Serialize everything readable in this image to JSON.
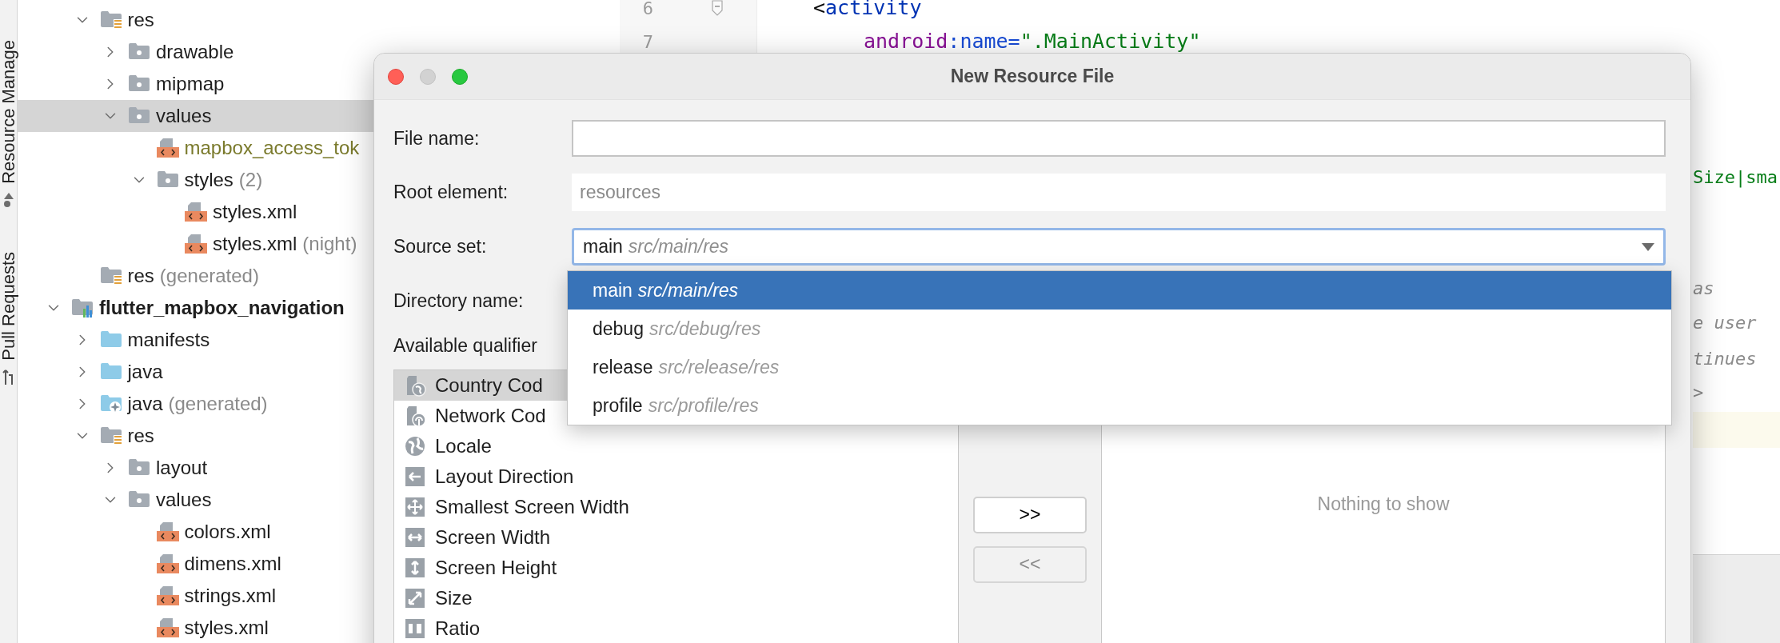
{
  "tool_strip": {
    "tabs": [
      {
        "label": "Resource Manage",
        "kind": "resources"
      },
      {
        "label": "Pull Requests",
        "kind": "pull"
      }
    ]
  },
  "project_tree": {
    "open_module_children": [
      {
        "label": "res",
        "kind": "res",
        "expanded": true,
        "selected": false,
        "children": [
          {
            "label": "drawable",
            "kind": "folder",
            "expanded": false,
            "selected": false
          },
          {
            "label": "mipmap",
            "kind": "folder",
            "expanded": false,
            "selected": false
          },
          {
            "label": "values",
            "kind": "folder",
            "expanded": true,
            "selected": true,
            "children": [
              {
                "label": "mapbox_access_tok",
                "kind": "xml",
                "selected": false,
                "color": "#7a7a2c"
              },
              {
                "label": "styles",
                "note": "(2)",
                "kind": "folder",
                "expanded": true,
                "selected": false,
                "children": [
                  {
                    "label": "styles.xml",
                    "kind": "xml",
                    "selected": false
                  },
                  {
                    "label": "styles.xml",
                    "note": "(night)",
                    "kind": "xml",
                    "selected": false
                  }
                ]
              }
            ]
          }
        ]
      },
      {
        "label": "res",
        "note": "(generated)",
        "kind": "res",
        "selected": false
      }
    ],
    "modules": [
      {
        "label": "flutter_mapbox_navigation",
        "kind": "module",
        "expanded": true,
        "selected": false,
        "children": [
          {
            "label": "manifests",
            "kind": "source",
            "expanded": false,
            "selected": false
          },
          {
            "label": "java",
            "kind": "source",
            "expanded": false,
            "selected": false
          },
          {
            "label": "java",
            "note": "(generated)",
            "kind": "generated",
            "expanded": false,
            "selected": false
          },
          {
            "label": "res",
            "kind": "res",
            "expanded": true,
            "selected": false,
            "children": [
              {
                "label": "layout",
                "kind": "folder",
                "expanded": false,
                "selected": false
              },
              {
                "label": "values",
                "kind": "folder",
                "expanded": true,
                "selected": false,
                "children": [
                  {
                    "label": "colors.xml",
                    "kind": "xml",
                    "selected": false
                  },
                  {
                    "label": "dimens.xml",
                    "kind": "xml",
                    "selected": false
                  },
                  {
                    "label": "strings.xml",
                    "kind": "xml",
                    "selected": false
                  },
                  {
                    "label": "styles.xml",
                    "kind": "xml",
                    "selected": false
                  }
                ]
              }
            ]
          }
        ]
      }
    ]
  },
  "editor": {
    "lines": [
      {
        "number": "6",
        "fold": true,
        "tokens": [
          {
            "text": "<",
            "kind": "punct"
          },
          {
            "text": "activity",
            "kind": "tag"
          }
        ]
      },
      {
        "number": "7",
        "fold": false,
        "tokens": [
          {
            "text": "android",
            "kind": "ns"
          },
          {
            "text": ":name=",
            "kind": "attr"
          },
          {
            "text": "\".MainActivity\"",
            "kind": "string"
          }
        ]
      }
    ],
    "right_fragments": [
      {
        "text": "Size|sma",
        "kind": "string"
      },
      {
        "text": "as",
        "kind": "comment"
      },
      {
        "text": "e user",
        "kind": "comment"
      },
      {
        "text": "tinues",
        "kind": "comment"
      },
      {
        "text": ">",
        "kind": "comment"
      }
    ],
    "caret_line_visible": true
  },
  "dialog": {
    "title": "New Resource File",
    "window_buttons": [
      {
        "kind": "close",
        "disabled": false
      },
      {
        "kind": "minimize",
        "disabled": true
      },
      {
        "kind": "zoom",
        "disabled": false
      }
    ],
    "file_name": {
      "label": "File name:"
    },
    "root_element": {
      "label": "Root element:",
      "value": "resources"
    },
    "source_set": {
      "label": "Source set:",
      "value": "main",
      "path": "src/main/res",
      "expanded": true,
      "options": [
        {
          "name": "main",
          "path": "src/main/res",
          "selected": true
        },
        {
          "name": "debug",
          "path": "src/debug/res",
          "selected": false
        },
        {
          "name": "release",
          "path": "src/release/res",
          "selected": false
        },
        {
          "name": "profile",
          "path": "src/profile/res",
          "selected": false
        }
      ]
    },
    "directory_name": {
      "label": "Directory name:"
    },
    "qualifiers_label": "Available qualifier",
    "qualifiers": [
      {
        "label": "Country Cod",
        "kind": "country",
        "selected": true
      },
      {
        "label": "Network Cod",
        "kind": "network",
        "selected": false
      },
      {
        "label": "Locale",
        "kind": "globe",
        "selected": false
      },
      {
        "label": "Layout Direction",
        "kind": "direction",
        "selected": false
      },
      {
        "label": "Smallest Screen Width",
        "kind": "move",
        "selected": false
      },
      {
        "label": "Screen Width",
        "kind": "width",
        "selected": false
      },
      {
        "label": "Screen Height",
        "kind": "height",
        "selected": false
      },
      {
        "label": "Size",
        "kind": "size",
        "selected": false
      },
      {
        "label": "Ratio",
        "kind": "ratio",
        "selected": false
      }
    ],
    "move_buttons": [
      {
        "label": ">>",
        "disabled": false
      },
      {
        "label": "<<",
        "disabled": true
      }
    ],
    "chosen_empty_text": "Nothing to show"
  }
}
